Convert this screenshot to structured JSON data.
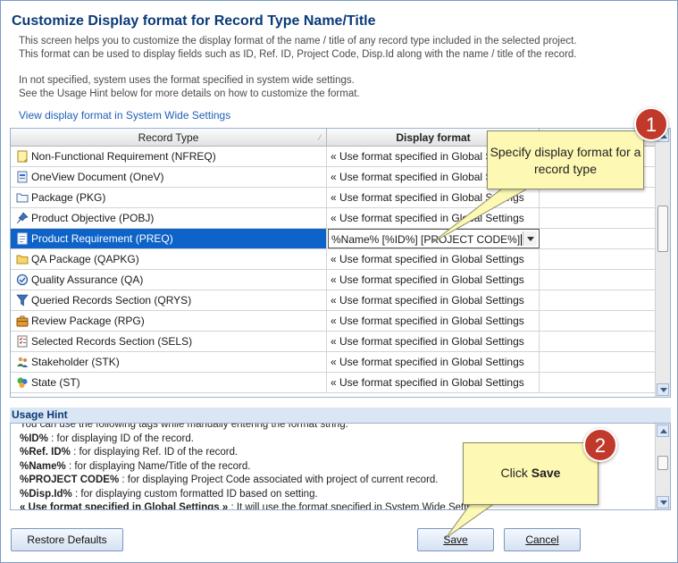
{
  "dialog": {
    "title": "Customize Display format for Record Type Name/Title",
    "description": [
      "This screen helps you to customize the display format of the name / title of any record type included in the selected project.",
      "This format can be used to display fields such as ID, Ref. ID, Project Code, Disp.Id along with the name / title of the record.",
      "In not specified, system uses the format specified in system wide settings.",
      "See the Usage Hint below for more details on how to customize the format."
    ],
    "system_link": "View display format in System Wide Settings"
  },
  "grid": {
    "headers": {
      "record_type": "Record Type",
      "display_format": "Display format"
    },
    "rows": [
      {
        "type": "Non-Functional Requirement (NFREQ)",
        "format": "« Use format specified in Global Settings",
        "icon": "note-icon"
      },
      {
        "type": "OneView Document (OneV)",
        "format": "« Use format specified in Global Settings",
        "icon": "document-icon"
      },
      {
        "type": "Package (PKG)",
        "format": "« Use format specified in Global Settings",
        "icon": "folder-outline-icon"
      },
      {
        "type": "Product Objective (POBJ)",
        "format": "« Use format specified in Global Settings",
        "icon": "pin-icon"
      },
      {
        "type": "Product Requirement (PREQ)",
        "format": "%Name% [%ID%] [PROJECT CODE%]",
        "icon": "page-icon",
        "selected": true
      },
      {
        "type": "QA Package (QAPKG)",
        "format": "« Use format specified in Global Settings",
        "icon": "folder-icon"
      },
      {
        "type": "Quality Assurance (QA)",
        "format": "« Use format specified in Global Settings",
        "icon": "check-circle-icon"
      },
      {
        "type": "Queried Records Section (QRYS)",
        "format": "« Use format specified in Global Settings",
        "icon": "funnel-icon"
      },
      {
        "type": "Review Package (RPG)",
        "format": "« Use format specified in Global Settings",
        "icon": "briefcase-icon"
      },
      {
        "type": "Selected Records Section (SELS)",
        "format": "« Use format specified in Global Settings",
        "icon": "checklist-icon"
      },
      {
        "type": "Stakeholder (STK)",
        "format": "« Use format specified in Global Settings",
        "icon": "users-icon"
      },
      {
        "type": "State (ST)",
        "format": "« Use format specified in Global Settings",
        "icon": "state-icon"
      }
    ]
  },
  "usage_hint": {
    "title": "Usage Hint",
    "partial_line": "You can use the following tags while manually entering the format string.",
    "items": [
      {
        "tag": "%ID%",
        "text": " : for displaying ID of the record."
      },
      {
        "tag": "%Ref. ID%",
        "text": " : for displaying Ref. ID of the record."
      },
      {
        "tag": "%Name%",
        "text": " : for displaying Name/Title of the record."
      },
      {
        "tag": "%PROJECT CODE%",
        "text": " : for displaying Project Code associated with project of current record."
      },
      {
        "tag": "%Disp.Id%",
        "text": " : for displaying custom formatted ID based on setting."
      },
      {
        "tag": "« Use format specified in Global Settings »",
        "text": " : It will use the format specified in System Wide Settings."
      }
    ]
  },
  "buttons": {
    "restore": "Restore Defaults",
    "save": "Save",
    "cancel": "Cancel"
  },
  "callouts": {
    "one": {
      "number": "1",
      "text": "Specify display format for a record type"
    },
    "two": {
      "number": "2",
      "text_prefix": "Click ",
      "text_bold": "Save"
    }
  },
  "colors": {
    "title": "#0a3a78",
    "link": "#1f5fb7",
    "selection": "#0e63c9",
    "callout": "#fdf8b3",
    "badge": "#c0392b"
  }
}
